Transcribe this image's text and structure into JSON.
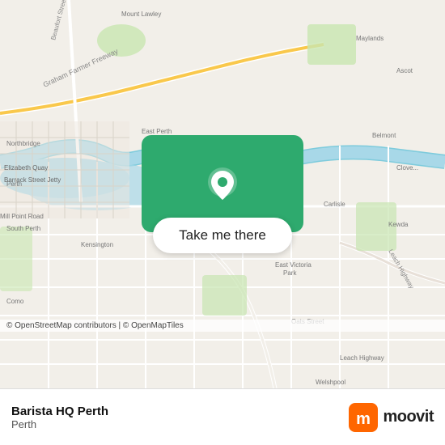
{
  "map": {
    "alt": "Map of Perth area"
  },
  "overlay": {
    "button_label": "Take me there"
  },
  "footer": {
    "location_name": "Barista HQ Perth",
    "location_city": "Perth",
    "moovit_label": "moovit"
  },
  "copyright": {
    "text": "© OpenStreetMap contributors | © OpenMapTiles"
  },
  "colors": {
    "green": "#2eaa6e",
    "moovit_orange": "#ff6600"
  }
}
